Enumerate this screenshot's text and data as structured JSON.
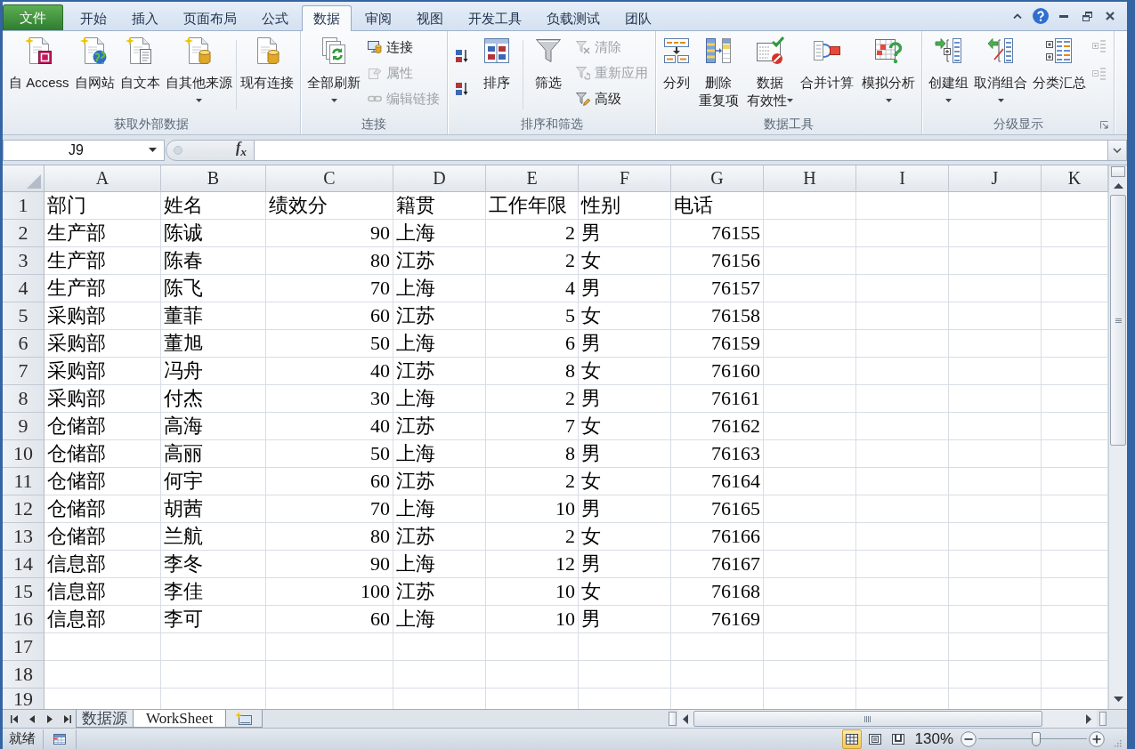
{
  "tabs": [
    {
      "label": "文件",
      "kind": "file",
      "selected": false
    },
    {
      "label": "开始",
      "kind": "tab",
      "selected": false
    },
    {
      "label": "插入",
      "kind": "tab",
      "selected": false
    },
    {
      "label": "页面布局",
      "kind": "tab",
      "selected": false
    },
    {
      "label": "公式",
      "kind": "tab",
      "selected": false
    },
    {
      "label": "数据",
      "kind": "tab",
      "selected": true
    },
    {
      "label": "审阅",
      "kind": "tab",
      "selected": false
    },
    {
      "label": "视图",
      "kind": "tab",
      "selected": false
    },
    {
      "label": "开发工具",
      "kind": "tab",
      "selected": false
    },
    {
      "label": "负载测试",
      "kind": "tab",
      "selected": false
    },
    {
      "label": "团队",
      "kind": "tab",
      "selected": false
    }
  ],
  "ribbon": {
    "groups": [
      {
        "title": "获取外部数据",
        "dialog_launcher": false,
        "items": [
          {
            "kind": "large",
            "label": [
              "自 Access"
            ],
            "dropdown": false
          },
          {
            "kind": "large",
            "label": [
              "自网站"
            ],
            "dropdown": false
          },
          {
            "kind": "large",
            "label": [
              "自文本"
            ],
            "dropdown": false
          },
          {
            "kind": "large",
            "label": [
              "自其他来源"
            ],
            "dropdown": true
          },
          {
            "kind": "separator"
          },
          {
            "kind": "large",
            "label": [
              "现有连接"
            ],
            "dropdown": false
          }
        ]
      },
      {
        "title": "连接",
        "dialog_launcher": false,
        "items": [
          {
            "kind": "large",
            "label": [
              "全部刷新"
            ],
            "dropdown": true
          },
          {
            "kind": "small_stack",
            "buttons": [
              {
                "label": "连接",
                "disabled": false
              },
              {
                "label": "属性",
                "disabled": true
              },
              {
                "label": "编辑链接",
                "disabled": true
              }
            ]
          }
        ]
      },
      {
        "title": "排序和筛选",
        "dialog_launcher": false,
        "items": [
          {
            "kind": "small_stack",
            "buttons": [
              {
                "disabled": false
              },
              {
                "disabled": false
              }
            ]
          },
          {
            "kind": "large",
            "label": [
              "排序"
            ],
            "dropdown": false
          },
          {
            "kind": "separator"
          },
          {
            "kind": "large",
            "label": [
              "筛选"
            ],
            "dropdown": false
          },
          {
            "kind": "small_stack",
            "buttons": [
              {
                "label": "清除",
                "disabled": true
              },
              {
                "label": "重新应用",
                "disabled": true
              },
              {
                "label": "高级",
                "disabled": false
              }
            ]
          }
        ]
      },
      {
        "title": "数据工具",
        "dialog_launcher": false,
        "items": [
          {
            "kind": "large",
            "label": [
              "分列"
            ],
            "dropdown": false
          },
          {
            "kind": "large",
            "label": [
              "删除",
              "重复项"
            ],
            "dropdown": false
          },
          {
            "kind": "large",
            "label": [
              "数据",
              "有效性"
            ],
            "dropdown": true
          },
          {
            "kind": "large",
            "label": [
              "合并计算"
            ],
            "dropdown": false
          },
          {
            "kind": "large",
            "label": [
              "模拟分析"
            ],
            "dropdown": true
          }
        ]
      },
      {
        "title": "分级显示",
        "dialog_launcher": true,
        "items": [
          {
            "kind": "large",
            "label": [
              "创建组"
            ],
            "dropdown": true
          },
          {
            "kind": "large",
            "label": [
              "取消组合"
            ],
            "dropdown": true
          },
          {
            "kind": "large",
            "label": [
              "分类汇总"
            ],
            "dropdown": false
          },
          {
            "kind": "small_stack",
            "buttons": [
              {
                "disabled": true
              },
              {
                "disabled": true
              }
            ]
          }
        ]
      }
    ]
  },
  "formula_bar": {
    "name_box": "J9",
    "insert_function": "f$_{x}$"
  },
  "sheet": {
    "columns": [
      "A",
      "B",
      "C",
      "D",
      "E",
      "F",
      "G",
      "H",
      "I",
      "J",
      "K"
    ],
    "rows": [
      {
        "number": "1",
        "cells": [
          {
            "text": "部门",
            "kind": "text"
          },
          {
            "text": "姓名",
            "kind": "text"
          },
          {
            "text": "绩效分",
            "kind": "text"
          },
          {
            "text": "籍贯",
            "kind": "text"
          },
          {
            "text": "工作年限",
            "kind": "text"
          },
          {
            "text": "性别",
            "kind": "text"
          },
          {
            "text": "电话",
            "kind": "text"
          }
        ]
      },
      {
        "number": "2",
        "cells": [
          {
            "text": "生产部",
            "kind": "text"
          },
          {
            "text": "陈诚",
            "kind": "text"
          },
          {
            "text": "90",
            "kind": "number"
          },
          {
            "text": "上海",
            "kind": "text"
          },
          {
            "text": "2",
            "kind": "number"
          },
          {
            "text": "男",
            "kind": "text"
          },
          {
            "text": "76155",
            "kind": "number"
          }
        ]
      },
      {
        "number": "3",
        "cells": [
          {
            "text": "生产部",
            "kind": "text"
          },
          {
            "text": "陈春",
            "kind": "text"
          },
          {
            "text": "80",
            "kind": "number"
          },
          {
            "text": "江苏",
            "kind": "text"
          },
          {
            "text": "2",
            "kind": "number"
          },
          {
            "text": "女",
            "kind": "text"
          },
          {
            "text": "76156",
            "kind": "number"
          }
        ]
      },
      {
        "number": "4",
        "cells": [
          {
            "text": "生产部",
            "kind": "text"
          },
          {
            "text": "陈飞",
            "kind": "text"
          },
          {
            "text": "70",
            "kind": "number"
          },
          {
            "text": "上海",
            "kind": "text"
          },
          {
            "text": "4",
            "kind": "number"
          },
          {
            "text": "男",
            "kind": "text"
          },
          {
            "text": "76157",
            "kind": "number"
          }
        ]
      },
      {
        "number": "5",
        "cells": [
          {
            "text": "采购部",
            "kind": "text"
          },
          {
            "text": "董菲",
            "kind": "text"
          },
          {
            "text": "60",
            "kind": "number"
          },
          {
            "text": "江苏",
            "kind": "text"
          },
          {
            "text": "5",
            "kind": "number"
          },
          {
            "text": "女",
            "kind": "text"
          },
          {
            "text": "76158",
            "kind": "number"
          }
        ]
      },
      {
        "number": "6",
        "cells": [
          {
            "text": "采购部",
            "kind": "text"
          },
          {
            "text": "董旭",
            "kind": "text"
          },
          {
            "text": "50",
            "kind": "number"
          },
          {
            "text": "上海",
            "kind": "text"
          },
          {
            "text": "6",
            "kind": "number"
          },
          {
            "text": "男",
            "kind": "text"
          },
          {
            "text": "76159",
            "kind": "number"
          }
        ]
      },
      {
        "number": "7",
        "cells": [
          {
            "text": "采购部",
            "kind": "text"
          },
          {
            "text": "冯舟",
            "kind": "text"
          },
          {
            "text": "40",
            "kind": "number"
          },
          {
            "text": "江苏",
            "kind": "text"
          },
          {
            "text": "8",
            "kind": "number"
          },
          {
            "text": "女",
            "kind": "text"
          },
          {
            "text": "76160",
            "kind": "number"
          }
        ]
      },
      {
        "number": "8",
        "cells": [
          {
            "text": "采购部",
            "kind": "text"
          },
          {
            "text": "付杰",
            "kind": "text"
          },
          {
            "text": "30",
            "kind": "number"
          },
          {
            "text": "上海",
            "kind": "text"
          },
          {
            "text": "2",
            "kind": "number"
          },
          {
            "text": "男",
            "kind": "text"
          },
          {
            "text": "76161",
            "kind": "number"
          }
        ]
      },
      {
        "number": "9",
        "cells": [
          {
            "text": "仓储部",
            "kind": "text"
          },
          {
            "text": "高海",
            "kind": "text"
          },
          {
            "text": "40",
            "kind": "number"
          },
          {
            "text": "江苏",
            "kind": "text"
          },
          {
            "text": "7",
            "kind": "number"
          },
          {
            "text": "女",
            "kind": "text"
          },
          {
            "text": "76162",
            "kind": "number"
          }
        ]
      },
      {
        "number": "10",
        "cells": [
          {
            "text": "仓储部",
            "kind": "text"
          },
          {
            "text": "高丽",
            "kind": "text"
          },
          {
            "text": "50",
            "kind": "number"
          },
          {
            "text": "上海",
            "kind": "text"
          },
          {
            "text": "8",
            "kind": "number"
          },
          {
            "text": "男",
            "kind": "text"
          },
          {
            "text": "76163",
            "kind": "number"
          }
        ]
      },
      {
        "number": "11",
        "cells": [
          {
            "text": "仓储部",
            "kind": "text"
          },
          {
            "text": "何宇",
            "kind": "text"
          },
          {
            "text": "60",
            "kind": "number"
          },
          {
            "text": "江苏",
            "kind": "text"
          },
          {
            "text": "2",
            "kind": "number"
          },
          {
            "text": "女",
            "kind": "text"
          },
          {
            "text": "76164",
            "kind": "number"
          }
        ]
      },
      {
        "number": "12",
        "cells": [
          {
            "text": "仓储部",
            "kind": "text"
          },
          {
            "text": "胡茜",
            "kind": "text"
          },
          {
            "text": "70",
            "kind": "number"
          },
          {
            "text": "上海",
            "kind": "text"
          },
          {
            "text": "10",
            "kind": "number"
          },
          {
            "text": "男",
            "kind": "text"
          },
          {
            "text": "76165",
            "kind": "number"
          }
        ]
      },
      {
        "number": "13",
        "cells": [
          {
            "text": "仓储部",
            "kind": "text"
          },
          {
            "text": "兰航",
            "kind": "text"
          },
          {
            "text": "80",
            "kind": "number"
          },
          {
            "text": "江苏",
            "kind": "text"
          },
          {
            "text": "2",
            "kind": "number"
          },
          {
            "text": "女",
            "kind": "text"
          },
          {
            "text": "76166",
            "kind": "number"
          }
        ]
      },
      {
        "number": "14",
        "cells": [
          {
            "text": "信息部",
            "kind": "text"
          },
          {
            "text": "李冬",
            "kind": "text"
          },
          {
            "text": "90",
            "kind": "number"
          },
          {
            "text": "上海",
            "kind": "text"
          },
          {
            "text": "12",
            "kind": "number"
          },
          {
            "text": "男",
            "kind": "text"
          },
          {
            "text": "76167",
            "kind": "number"
          }
        ]
      },
      {
        "number": "15",
        "cells": [
          {
            "text": "信息部",
            "kind": "text"
          },
          {
            "text": "李佳",
            "kind": "text"
          },
          {
            "text": "100",
            "kind": "number"
          },
          {
            "text": "江苏",
            "kind": "text"
          },
          {
            "text": "10",
            "kind": "number"
          },
          {
            "text": "女",
            "kind": "text"
          },
          {
            "text": "76168",
            "kind": "number"
          }
        ]
      },
      {
        "number": "16",
        "cells": [
          {
            "text": "信息部",
            "kind": "text"
          },
          {
            "text": "李可",
            "kind": "text"
          },
          {
            "text": "60",
            "kind": "number"
          },
          {
            "text": "上海",
            "kind": "text"
          },
          {
            "text": "10",
            "kind": "number"
          },
          {
            "text": "男",
            "kind": "text"
          },
          {
            "text": "76169",
            "kind": "number"
          }
        ]
      },
      {
        "number": "17"
      },
      {
        "number": "18"
      },
      {
        "number": "19"
      }
    ]
  },
  "sheet_tabs": [
    {
      "label": "数据源",
      "selected": false
    },
    {
      "label": "WorkSheet",
      "selected": true
    }
  ],
  "status_bar": {
    "status": "就绪",
    "view_buttons": [
      {
        "selected": true
      },
      {
        "selected": false
      },
      {
        "selected": false
      }
    ],
    "zoom": "130%",
    "zoom_slider": {
      "level": 0.53
    }
  }
}
